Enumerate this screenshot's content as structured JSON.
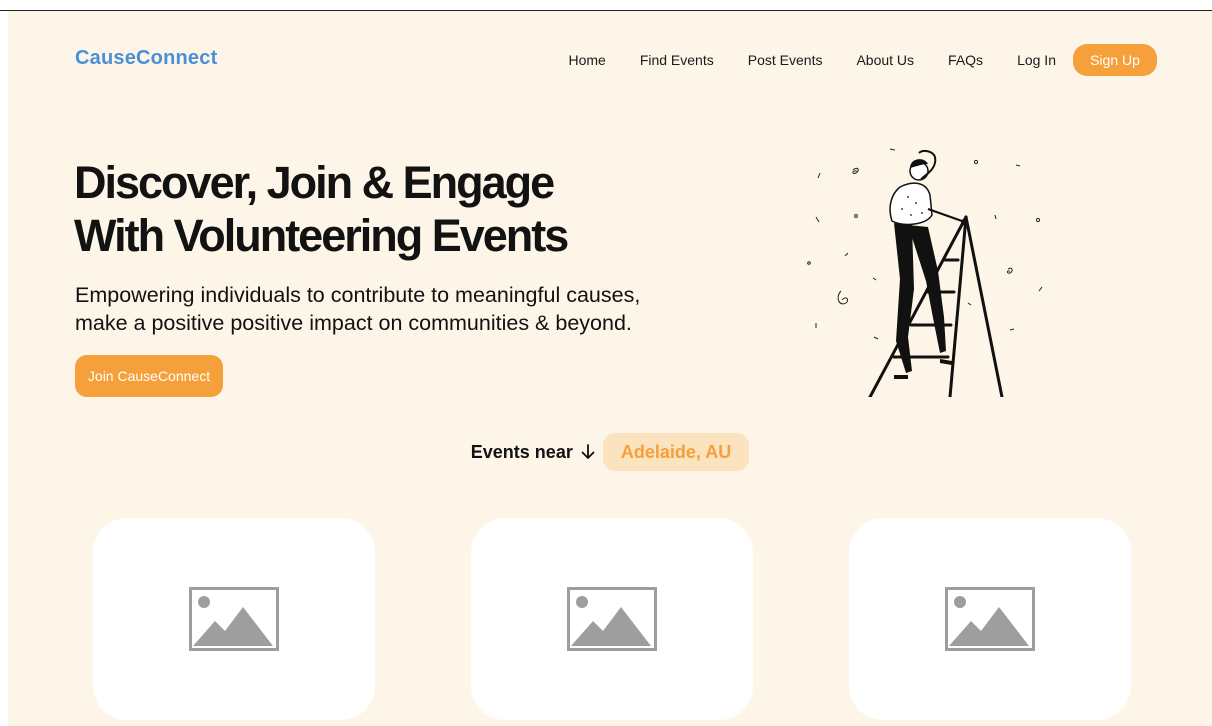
{
  "header": {
    "logo": "CauseConnect",
    "nav": [
      "Home",
      "Find Events",
      "Post Events",
      "About Us",
      "FAQs",
      "Log In"
    ],
    "signup_label": "Sign Up"
  },
  "hero": {
    "title_line1": "Discover, Join & Engage",
    "title_line2": "With Volunteering Events",
    "subtitle_line1": "Empowering individuals to contribute to meaningful causes,",
    "subtitle_line2": "make a positive positive impact on communities & beyond.",
    "cta_label": "Join CauseConnect"
  },
  "events": {
    "label": "Events near",
    "location": "Adelaide, AU"
  },
  "icons": {
    "arrow": "arrow-down-icon",
    "placeholder": "image-placeholder-icon"
  },
  "colors": {
    "accent": "#f5a03a",
    "brand": "#4a90d9",
    "background": "#fdf6e8",
    "pill": "#fbe3bf"
  }
}
